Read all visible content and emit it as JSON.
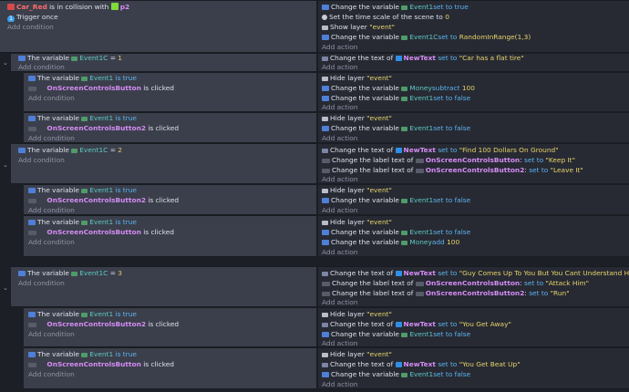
{
  "trigger": {
    "object": "Car_Red",
    "text": "is in collision with",
    "target": "p2",
    "once": "Trigger once",
    "add_condition": "Add condition"
  },
  "trigger_actions": [
    {
      "a": "Change the variable",
      "b": "Event1",
      "c": "set to true"
    },
    {
      "a": "Set the time scale of the scene to",
      "b": "0",
      "c": ""
    },
    {
      "a": "Show layer",
      "b": "\"event\"",
      "c": ""
    },
    {
      "a": "Change the variable",
      "b": "Event1C",
      "c": "set to",
      "d": "RandomInRange(1,3)"
    }
  ],
  "add_action": "Add action",
  "e1": {
    "cond": "The variable",
    "var": "Event1C",
    "op": "=",
    "val": "1",
    "act_a": "Change the text of",
    "act_obj": "NewText",
    "act_set": "set to",
    "act_str": "\"Car has a flat tire\""
  },
  "e1a": {
    "c1a": "The variable",
    "c1b": "Event1",
    "c1c": "is true",
    "c2": "OnScreenControlsButton",
    "c2b": "is clicked",
    "actions": [
      {
        "a": "Hide layer",
        "b": "\"event\""
      },
      {
        "a": "Change the variable",
        "b": "Money",
        "c": "subtract",
        "d": "100"
      },
      {
        "a": "Change the variable",
        "b": "Event1",
        "c": "set to false"
      }
    ]
  },
  "e1b": {
    "c1a": "The variable",
    "c1b": "Event1",
    "c1c": "is true",
    "c2": "OnScreenControlsButton2",
    "c2b": "is clicked",
    "actions": [
      {
        "a": "Hide layer",
        "b": "\"event\""
      },
      {
        "a": "Change the variable",
        "b": "Event1",
        "c": "set to false"
      }
    ]
  },
  "e2": {
    "cond": "The variable",
    "var": "Event1C",
    "op": "=",
    "val": "2",
    "actions": [
      {
        "a": "Change the text of",
        "b": "NewText",
        "c": "set to",
        "d": "\"Find 100 Dollars On Ground\""
      },
      {
        "a": "Change the label text of",
        "b": "OnScreenControlsButton",
        "c": "set to",
        "d": "\"Keep It\""
      },
      {
        "a": "Change the label text of",
        "b": "OnScreenControlsButton2",
        "c": "set to",
        "d": "\"Leave It\""
      }
    ]
  },
  "e2a": {
    "c1a": "The variable",
    "c1b": "Event1",
    "c1c": "is true",
    "c2": "OnScreenControlsButton2",
    "c2b": "is clicked",
    "actions": [
      {
        "a": "Hide layer",
        "b": "\"event\""
      },
      {
        "a": "Change the variable",
        "b": "Event1",
        "c": "set to false"
      }
    ]
  },
  "e2b": {
    "c1a": "The variable",
    "c1b": "Event1",
    "c1c": "is true",
    "c2": "OnScreenControlsButton",
    "c2b": "is clicked",
    "actions": [
      {
        "a": "Hide layer",
        "b": "\"event\""
      },
      {
        "a": "Change the variable",
        "b": "Event1",
        "c": "set to false"
      },
      {
        "a": "Change the variable",
        "b": "Money",
        "c": "add",
        "d": "100"
      }
    ]
  },
  "e3": {
    "cond": "The variable",
    "var": "Event1C",
    "op": "=",
    "val": "3",
    "actions": [
      {
        "a": "Change the text of",
        "b": "NewText",
        "c": "set to",
        "d": "\"Guy Comes Up To You But You Cant Understand Him\""
      },
      {
        "a": "Change the label text of",
        "b": "OnScreenControlsButton",
        "c": "set to",
        "d": "\"Attack Him\""
      },
      {
        "a": "Change the label text of",
        "b": "OnScreenControlsButton2",
        "c": "set to",
        "d": "\"Run\""
      }
    ]
  },
  "e3a": {
    "c1a": "The variable",
    "c1b": "Event1",
    "c1c": "is true",
    "c2": "OnScreenControlsButton2",
    "c2b": "is clicked",
    "actions": [
      {
        "a": "Hide layer",
        "b": "\"event\""
      },
      {
        "a": "Change the text of",
        "b": "NewText",
        "c": "set to",
        "d": "\"You Get Away\""
      },
      {
        "a": "Change the variable",
        "b": "Event1",
        "c": "set to false"
      }
    ]
  },
  "e3b": {
    "c1a": "The variable",
    "c1b": "Event1",
    "c1c": "is true",
    "c2": "OnScreenControlsButton",
    "c2b": "is clicked",
    "actions": [
      {
        "a": "Hide layer",
        "b": "\"event\""
      },
      {
        "a": "Change the text of",
        "b": "NewText",
        "c": "set to",
        "d": "\"You Get Beat Up\""
      },
      {
        "a": "Change the variable",
        "b": "Event1",
        "c": "set to false"
      }
    ]
  }
}
